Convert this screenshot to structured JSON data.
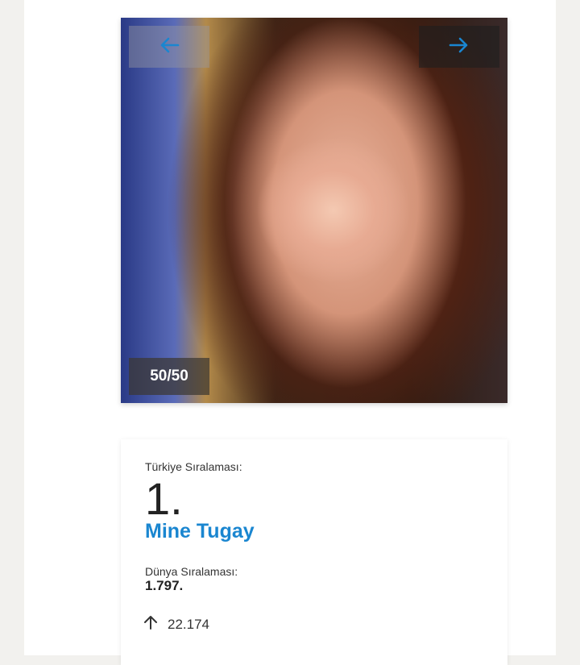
{
  "gallery": {
    "prev_icon": "arrow-left-icon",
    "next_icon": "arrow-right-icon",
    "counter": "50/50",
    "accent_color": "#1a86d0"
  },
  "profile": {
    "turkey_rank_label": "Türkiye Sıralaması:",
    "turkey_rank": "1.",
    "name": "Mine Tugay",
    "world_rank_label": "Dünya Sıralaması:",
    "world_rank": "1.797.",
    "trend_icon": "arrow-up-icon",
    "trend_value": "22.174"
  }
}
